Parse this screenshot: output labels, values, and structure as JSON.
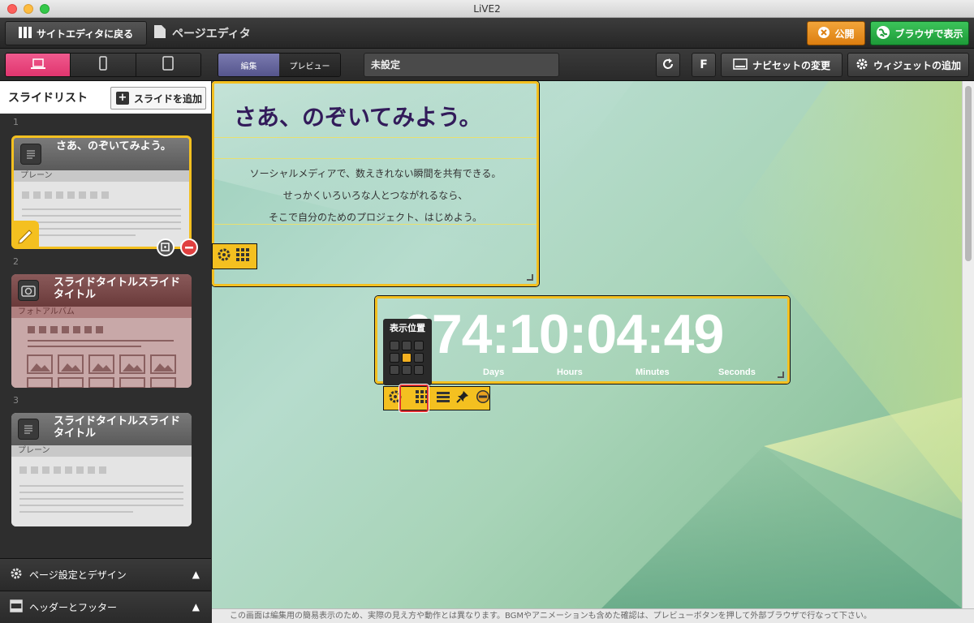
{
  "window": {
    "title": "LiVE2"
  },
  "topbar": {
    "back_label": "サイトエディタに戻る",
    "page_title": "ページエディタ",
    "publish_label": "公開",
    "browser_label": "ブラウザで表示"
  },
  "toolbar": {
    "edit_label": "編集",
    "preview_label": "プレビュー",
    "page_setting_value": "未設定",
    "f_label": "F",
    "navset_label": "ナビセットの変更",
    "widget_add_label": "ウィジェットの追加"
  },
  "sidebar": {
    "title": "スライドリスト",
    "add_slide_label": "スライドを追加",
    "slides": [
      {
        "num": "1",
        "title": "さあ、のぞいてみよう。",
        "type": "プレーン"
      },
      {
        "num": "2",
        "title": "スライドタイトルスライドタイトル",
        "type": "フォトアルバム"
      },
      {
        "num": "3",
        "title": "スライドタイトルスライドタイトル",
        "type": "プレーン"
      }
    ],
    "page_design_label": "ページ設定とデザイン",
    "header_footer_label": "ヘッダーとフッター"
  },
  "canvas": {
    "heading": "さあ、のぞいてみよう。",
    "body_lines": [
      "ソーシャルメディアで、数えきれない瞬間を共有できる。",
      "せっかくいろいろな人とつながれるなら、",
      "そこで自分のためのプロジェクト、はじめよう。"
    ],
    "countdown": "674:10:04:49",
    "units": {
      "days": "Days",
      "hours": "Hours",
      "minutes": "Minutes",
      "seconds": "Seconds"
    },
    "position_label": "表示位置"
  },
  "footer": {
    "note": "この画面は編集用の簡易表示のため、実際の見え方や動作とは異なります。BGMやアニメーションも含めた確認は、プレビューボタンを押して外部ブラウザで行なって下さい。"
  },
  "colors": {
    "accent_pink": "#e0356e",
    "publish_orange": "#dc7e10",
    "browser_green": "#1d9a38",
    "widget_yellow": "#f4c020",
    "heading_purple": "#321b5a"
  }
}
